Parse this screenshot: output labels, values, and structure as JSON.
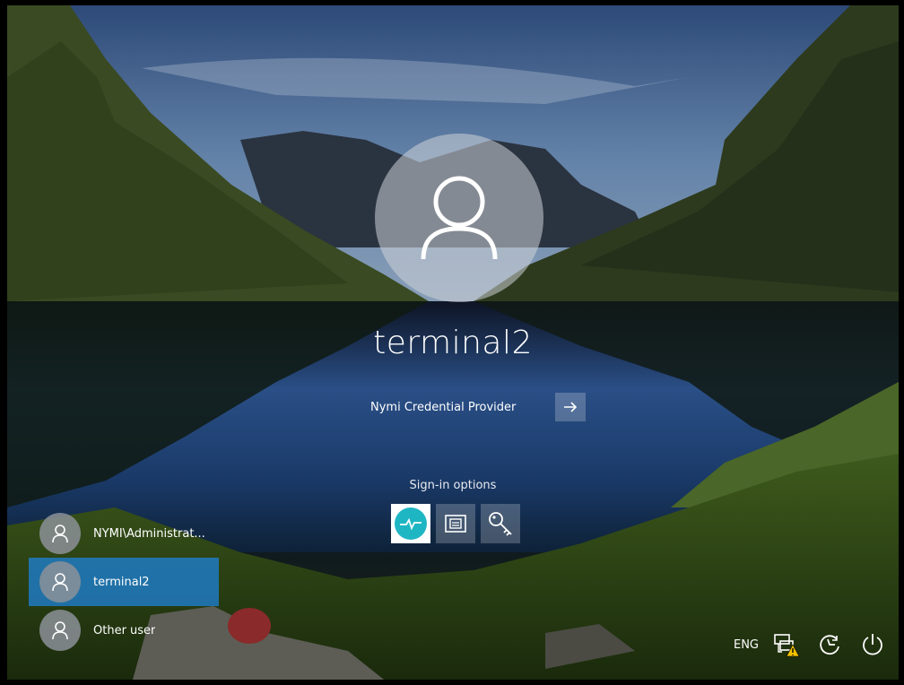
{
  "user": {
    "name": "terminal2"
  },
  "provider": {
    "label": "Nymi Credential Provider",
    "submit_icon": "arrow-right-icon"
  },
  "signin_options": {
    "title": "Sign-in options",
    "options": [
      {
        "icon": "nymi-heartbeat-icon",
        "selected": true
      },
      {
        "icon": "smart-card-icon",
        "selected": false
      },
      {
        "icon": "key-icon",
        "selected": false
      }
    ]
  },
  "users": [
    {
      "name": "NYMI\\Administrat..."
    },
    {
      "name": "terminal2"
    },
    {
      "name": "Other user"
    }
  ],
  "tray": {
    "language": "ENG",
    "network_icon": "network-warning-icon",
    "ease_icon": "ease-of-access-icon",
    "power_icon": "power-icon"
  },
  "colors": {
    "selected_user": "#1f7dc8",
    "nymi_teal": "#1fb6c4",
    "warning": "#f2c200"
  }
}
